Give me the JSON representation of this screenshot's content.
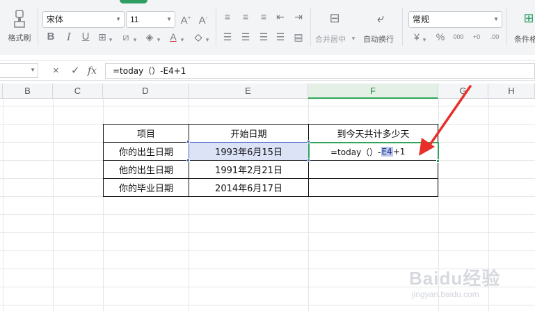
{
  "ribbon": {
    "format_painter_label": "格式刷",
    "font_name": "宋体",
    "font_size": "11",
    "merge_label": "合并居中",
    "wrap_label": "自动换行",
    "number_format": "常规",
    "cond_format_label": "条件格",
    "icons": [
      "bold-icon",
      "italic-icon",
      "underline-icon",
      "border-icon",
      "fill-color-icon",
      "font-color-icon",
      "clear-icon"
    ]
  },
  "formula_bar": {
    "cancel": "×",
    "confirm": "✓",
    "fx": "fx",
    "formula": "=today（）-E4+1"
  },
  "columns": [
    "B",
    "C",
    "D",
    "E",
    "F",
    "G",
    "H"
  ],
  "active_column": "F",
  "table": {
    "headers": [
      "项目",
      "开始日期",
      "到今天共计多少天"
    ],
    "rows": [
      {
        "item": "你的出生日期",
        "date": "1993年6月15日"
      },
      {
        "item": "他的出生日期",
        "date": "1991年2月21日"
      },
      {
        "item": "你的毕业日期",
        "date": "2014年6月17日"
      }
    ],
    "editing_cell": {
      "prefix": "=today（）-",
      "ref": "E4",
      "suffix": "+1"
    }
  },
  "colors": {
    "accent_green": "#2ea65a",
    "ref_blue": "#3b5fc2",
    "arrow_red": "#e8302a"
  },
  "watermark": {
    "logo_text": "Baidu经验",
    "url": "jingyan.baidu.com"
  }
}
